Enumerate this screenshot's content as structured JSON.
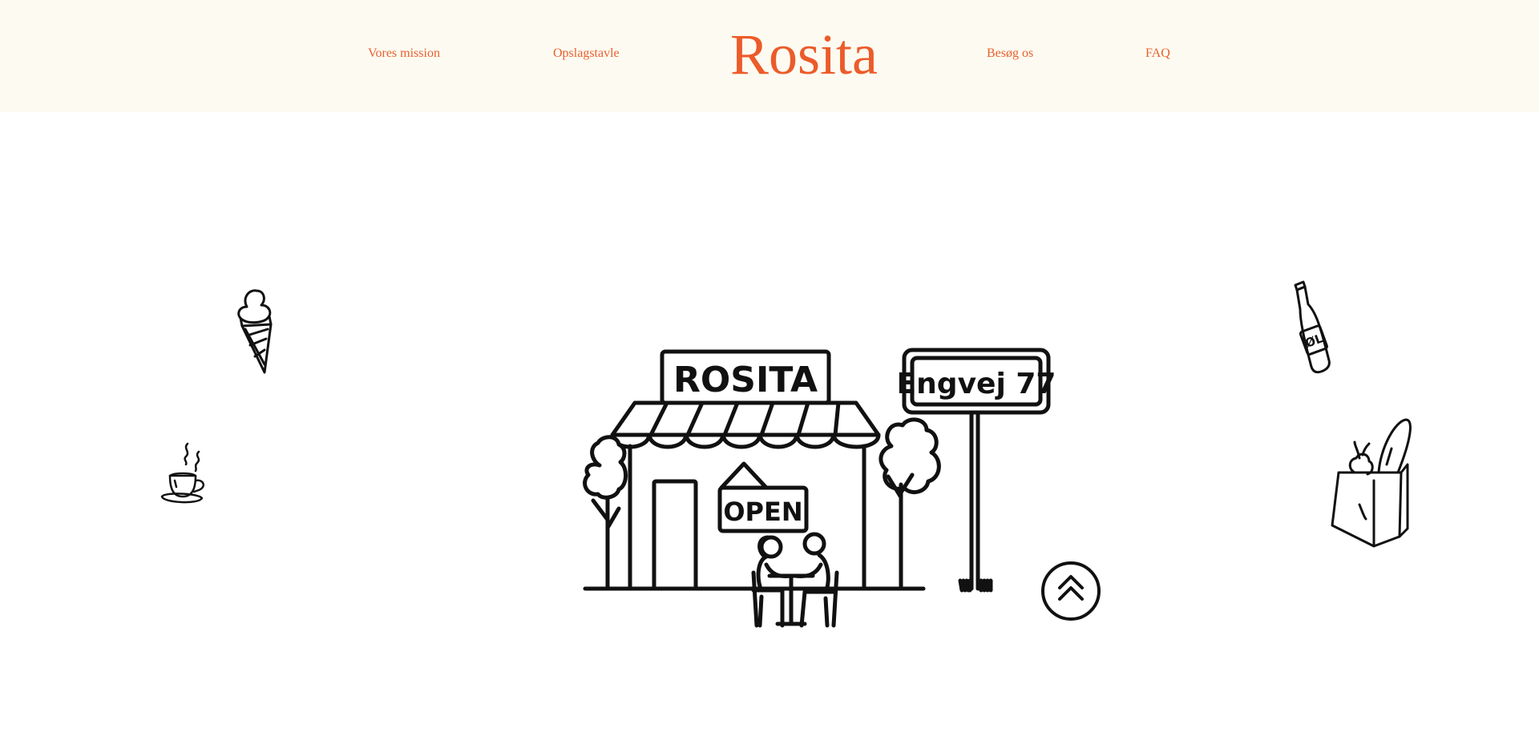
{
  "header": {
    "logo": "Rosita",
    "nav_left": [
      {
        "label": "Vores mission"
      },
      {
        "label": "Opslagstavle"
      }
    ],
    "nav_right": [
      {
        "label": "Besøg os"
      },
      {
        "label": "FAQ"
      }
    ]
  },
  "illustration": {
    "shop_sign": "ROSITA",
    "open_sign": "OPEN",
    "street_sign": "Engvej 77",
    "beer_label": "ØL"
  },
  "icons": {
    "ice_cream": "ice-cream-icon",
    "coffee": "coffee-cup-icon",
    "beer": "beer-bottle-icon",
    "grocery": "grocery-bag-icon",
    "scroll_top": "double-chevron-up-icon"
  },
  "colors": {
    "accent": "#ec5b2a",
    "header_bg": "#fdfbf1",
    "ink": "#111111"
  }
}
